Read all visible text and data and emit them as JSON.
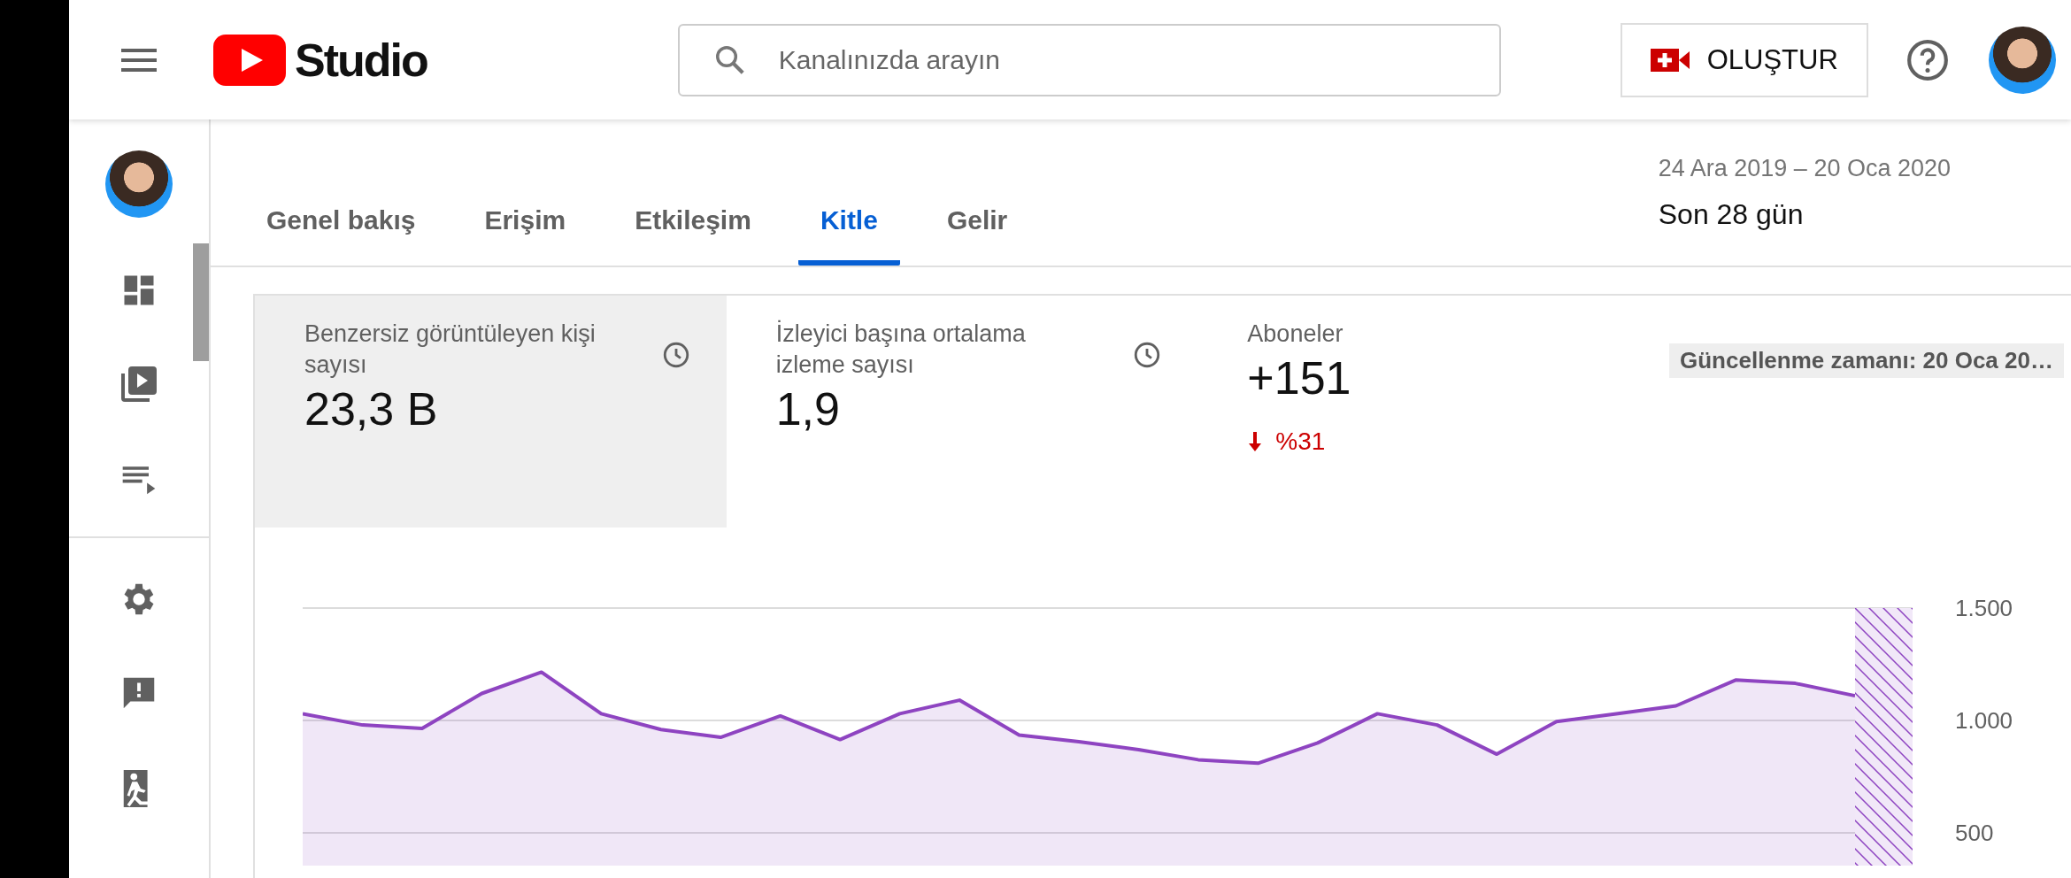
{
  "header": {
    "logo_text": "Studio",
    "search": {
      "placeholder": "Kanalınızda arayın"
    },
    "create_button": "OLUŞTUR"
  },
  "tabs": [
    {
      "label": "Genel bakış",
      "selected": false
    },
    {
      "label": "Erişim",
      "selected": false
    },
    {
      "label": "Etkileşim",
      "selected": false
    },
    {
      "label": "Kitle",
      "selected": true
    },
    {
      "label": "Gelir",
      "selected": false
    }
  ],
  "date_range": {
    "dates": "24 Ara 2019 – 20 Oca 2020",
    "period": "Son 28 gün"
  },
  "metrics": [
    {
      "label": "Benzersiz görüntüleyen kişi sayısı",
      "value": "23,3 B",
      "selected": true,
      "show_clock": true
    },
    {
      "label": "İzleyici başına ortalama izleme sayısı",
      "value": "1,9",
      "selected": false,
      "show_clock": true
    },
    {
      "label": "Aboneler",
      "value": "+151",
      "selected": false,
      "show_clock": false,
      "change": {
        "down": true,
        "text": "%31"
      }
    }
  ],
  "update_badge": "Güncellenme zamanı: 20 Oca 20…",
  "chart": {
    "chart_data": {
      "type": "area",
      "ylim": [
        500,
        1500
      ],
      "yticks": [
        {
          "value": 1500,
          "label": "1.500"
        },
        {
          "value": 1000,
          "label": "1.000"
        },
        {
          "value": 500,
          "label": "500"
        }
      ],
      "series": [
        {
          "color": "#8e44c1",
          "values": [
            1030,
            980,
            965,
            1120,
            1215,
            1030,
            960,
            925,
            1020,
            915,
            1030,
            1090,
            935,
            905,
            870,
            825,
            810,
            900,
            1030,
            980,
            850,
            995,
            1030,
            1065,
            1180,
            1165,
            1110
          ]
        }
      ]
    }
  }
}
